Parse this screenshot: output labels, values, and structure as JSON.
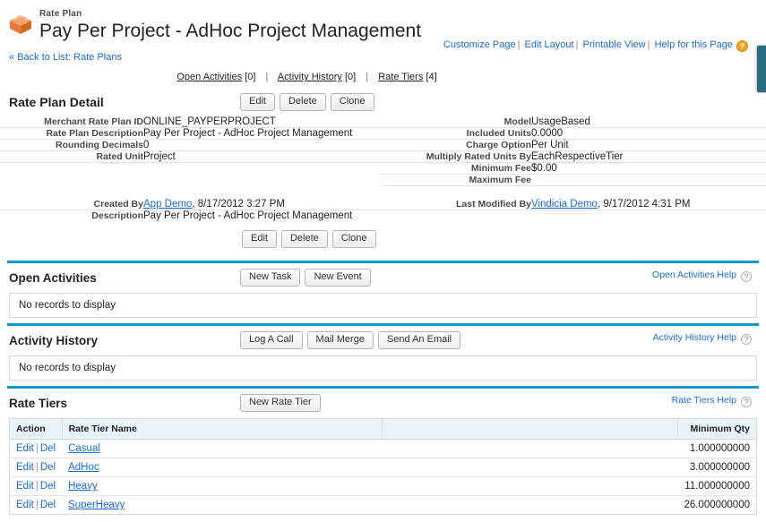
{
  "header": {
    "object_type": "Rate Plan",
    "record_title": "Pay Per Project - AdHoc Project Management",
    "icon": "orange-crate-icon",
    "top_links": [
      {
        "label": "Customize Page"
      },
      {
        "label": "Edit Layout"
      },
      {
        "label": "Printable View"
      },
      {
        "label": "Help for this Page"
      }
    ],
    "help_orb": "?",
    "back_chevron": "«",
    "back_label": "Back to List:",
    "back_target": "Rate Plans"
  },
  "section_nav": [
    {
      "label": "Open Activities",
      "count": "[0]"
    },
    {
      "label": "Activity History",
      "count": "[0]"
    },
    {
      "label": "Rate Tiers",
      "count": "[4]"
    }
  ],
  "detail": {
    "title": "Rate Plan Detail",
    "buttons": [
      "Edit",
      "Delete",
      "Clone"
    ],
    "rows": [
      {
        "l_label": "Merchant Rate Plan ID",
        "l_value": "ONLINE_PAYPERPROJECT",
        "r_label": "Model",
        "r_value": "UsageBased"
      },
      {
        "l_label": "Rate Plan Description",
        "l_value": "Pay Per Project - AdHoc Project Management",
        "r_label": "Included Units",
        "r_value": "0.0000"
      },
      {
        "l_label": "Rounding Decimals",
        "l_value": "0",
        "r_label": "Charge Option",
        "r_value": "Per Unit"
      },
      {
        "l_label": "Rated Unit",
        "l_value": "Project",
        "r_label": "Multiply Rated Units By",
        "r_value": "EachRespectiveTier"
      },
      {
        "l_label": "",
        "l_value": "",
        "r_label": "Minimum Fee",
        "r_value": "$0.00"
      },
      {
        "l_label": "",
        "l_value": "",
        "r_label": "Maximum Fee",
        "r_value": ""
      }
    ],
    "system_rows": [
      {
        "l_label": "Created By",
        "l_link": "App Demo",
        "l_rest": ", 8/17/2012 3:27 PM",
        "r_label": "Last Modified By",
        "r_link": "Vindicia Demo",
        "r_rest": ", 9/17/2012 4:31 PM"
      }
    ],
    "description_label": "Description",
    "description_value": "Pay Per Project - AdHoc Project Management",
    "bottom_buttons": [
      "Edit",
      "Delete",
      "Clone"
    ]
  },
  "open_activities": {
    "title": "Open Activities",
    "buttons": [
      "New Task",
      "New Event"
    ],
    "help_label": "Open Activities Help",
    "empty_message": "No records to display"
  },
  "activity_history": {
    "title": "Activity History",
    "buttons": [
      "Log A Call",
      "Mail Merge",
      "Send An Email"
    ],
    "help_label": "Activity History Help",
    "empty_message": "No records to display"
  },
  "rate_tiers": {
    "title": "Rate Tiers",
    "buttons": [
      "New Rate Tier"
    ],
    "help_label": "Rate Tiers Help",
    "columns": [
      "Action",
      "Rate Tier Name",
      "",
      "Minimum Qty"
    ],
    "row_actions": {
      "edit": "Edit",
      "del": "Del",
      "sep": "|"
    },
    "rows": [
      {
        "name": "Casual",
        "min_qty": "1.000000000"
      },
      {
        "name": "AdHoc",
        "min_qty": "3.000000000"
      },
      {
        "name": "Heavy",
        "min_qty": "11.000000000"
      },
      {
        "name": "SuperHeavy",
        "min_qty": "26.000000000"
      }
    ]
  },
  "colors": {
    "section_rule": "#1797c8",
    "link": "#1b6ac9",
    "accent_orange": "#f0a11e",
    "edge_tab": "#2b6c81",
    "table_header": "#e8f3fb"
  }
}
